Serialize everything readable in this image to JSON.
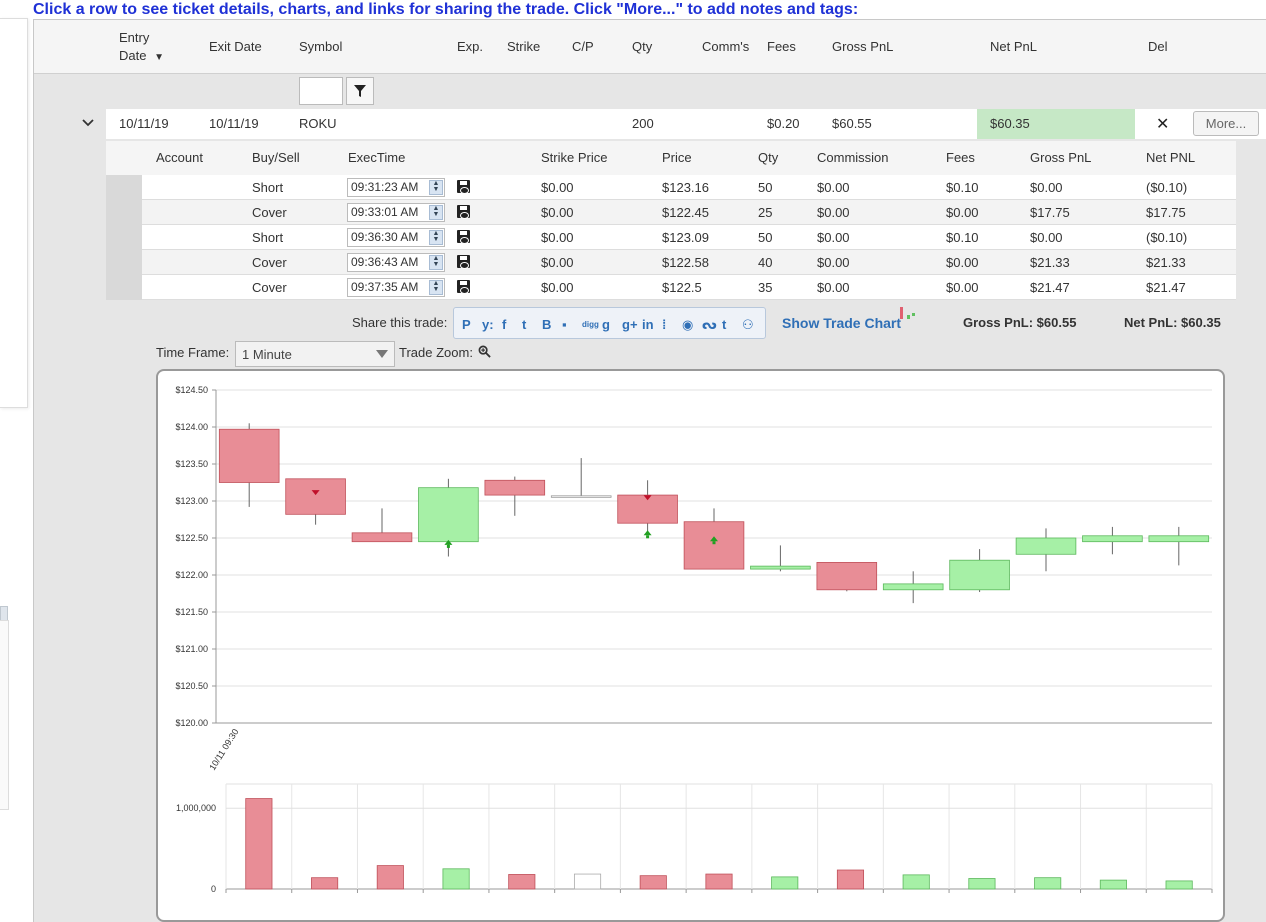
{
  "instructions": "Click a row to see ticket details, charts, and links for sharing the trade. Click \"More...\" to add notes and tags:",
  "grid": {
    "columns": {
      "entry_date_line1": "Entry",
      "entry_date_line2": "Date",
      "exit_date": "Exit Date",
      "symbol": "Symbol",
      "exp": "Exp.",
      "strike": "Strike",
      "cp": "C/P",
      "qty": "Qty",
      "comms": "Comm's",
      "fees": "Fees",
      "gross_pnl": "Gross PnL",
      "net_pnl": "Net PnL",
      "del": "Del"
    },
    "sort_indicator": "▼",
    "filter_value": ""
  },
  "trade": {
    "entry_date": "10/11/19",
    "exit_date": "10/11/19",
    "symbol": "ROKU",
    "qty": "200",
    "fees": "$0.20",
    "gross_pnl": "$60.55",
    "net_pnl": "$60.35",
    "delete_symbol": "✕",
    "more_label": "More..."
  },
  "details": {
    "headers": {
      "account": "Account",
      "buy_sell": "Buy/Sell",
      "exec_time": "ExecTime",
      "strike_price": "Strike Price",
      "price": "Price",
      "qty": "Qty",
      "commission": "Commission",
      "fees": "Fees",
      "gross_pnl": "Gross PnL",
      "net_pnl": "Net PNL"
    },
    "rows": [
      {
        "account": "",
        "side": "Short",
        "time": "09:31:23 AM",
        "strike": "$0.00",
        "price": "$123.16",
        "qty": "50",
        "commission": "$0.00",
        "fees": "$0.10",
        "gross": "$0.00",
        "net": "($0.10)"
      },
      {
        "account": "",
        "side": "Cover",
        "time": "09:33:01 AM",
        "strike": "$0.00",
        "price": "$122.45",
        "qty": "25",
        "commission": "$0.00",
        "fees": "$0.00",
        "gross": "$17.75",
        "net": "$17.75"
      },
      {
        "account": "",
        "side": "Short",
        "time": "09:36:30 AM",
        "strike": "$0.00",
        "price": "$123.09",
        "qty": "50",
        "commission": "$0.00",
        "fees": "$0.10",
        "gross": "$0.00",
        "net": "($0.10)"
      },
      {
        "account": "",
        "side": "Cover",
        "time": "09:36:43 AM",
        "strike": "$0.00",
        "price": "$122.58",
        "qty": "40",
        "commission": "$0.00",
        "fees": "$0.00",
        "gross": "$21.33",
        "net": "$21.33"
      },
      {
        "account": "",
        "side": "Cover",
        "time": "09:37:35 AM",
        "strike": "$0.00",
        "price": "$122.5",
        "qty": "35",
        "commission": "$0.00",
        "fees": "$0.00",
        "gross": "$21.47",
        "net": "$21.47"
      }
    ]
  },
  "share": {
    "label": "Share this trade:",
    "icons": [
      "pinterest-icon",
      "yahoo-icon",
      "facebook-icon",
      "twitter-icon",
      "blogger-icon",
      "delicious-icon",
      "digg-icon",
      "google-icon",
      "google-plus-icon",
      "linkedin-icon",
      "myspace-icon",
      "reddit-icon",
      "stumbleupon-icon",
      "tumblr-icon",
      "friends-icon"
    ],
    "icon_glyphs": [
      "P",
      "y:",
      "f",
      "t",
      "B",
      "▪",
      "digg",
      "g",
      "g+",
      "in",
      "⁞",
      "◉",
      "ᔓ",
      "t",
      "⚇"
    ],
    "show_chart_label": "Show Trade Chart",
    "gross_summary": "Gross PnL: $60.55",
    "net_summary": "Net PnL: $60.35"
  },
  "chart_controls": {
    "timeframe_label": "Time Frame:",
    "timeframe_value": "1 Minute",
    "zoom_label": "Trade Zoom:"
  },
  "colors": {
    "accent": "#1f31d6",
    "link": "#2f6fb6",
    "bear": "#e88d96",
    "bull": "#a6f0a6",
    "net_pnl_bg": "#c6e8c6"
  },
  "chart_data": {
    "type": "candlestick",
    "x_tick_labels": [
      "10/11 09:30"
    ],
    "ylim": [
      120.0,
      124.5
    ],
    "y_tick_labels": [
      "$124.50",
      "$124.00",
      "$123.50",
      "$123.00",
      "$122.50",
      "$122.00",
      "$121.50",
      "$121.00",
      "$120.50",
      "$120.00"
    ],
    "candles": [
      {
        "open": 123.97,
        "high": 124.05,
        "low": 122.92,
        "close": 123.25
      },
      {
        "open": 123.3,
        "high": 123.3,
        "low": 122.68,
        "close": 122.82
      },
      {
        "open": 122.57,
        "high": 122.9,
        "low": 122.45,
        "close": 122.45
      },
      {
        "open": 122.45,
        "high": 123.3,
        "low": 122.25,
        "close": 123.18
      },
      {
        "open": 123.28,
        "high": 123.33,
        "low": 122.8,
        "close": 123.08
      },
      {
        "open": 123.07,
        "high": 123.58,
        "low": 123.07,
        "close": 123.07
      },
      {
        "open": 123.08,
        "high": 123.28,
        "low": 122.58,
        "close": 122.7
      },
      {
        "open": 122.72,
        "high": 122.9,
        "low": 122.08,
        "close": 122.08
      },
      {
        "open": 122.08,
        "high": 122.4,
        "low": 122.05,
        "close": 122.12
      },
      {
        "open": 122.17,
        "high": 122.17,
        "low": 121.78,
        "close": 121.8
      },
      {
        "open": 121.8,
        "high": 122.05,
        "low": 121.62,
        "close": 121.88
      },
      {
        "open": 121.8,
        "high": 122.35,
        "low": 121.77,
        "close": 122.2
      },
      {
        "open": 122.28,
        "high": 122.63,
        "low": 122.05,
        "close": 122.5
      },
      {
        "open": 122.45,
        "high": 122.65,
        "low": 122.28,
        "close": 122.53
      },
      {
        "open": 122.45,
        "high": 122.65,
        "low": 122.13,
        "close": 122.53
      }
    ],
    "markers": [
      {
        "candle": 1,
        "price": 123.12,
        "side": "short"
      },
      {
        "candle": 3,
        "price": 122.42,
        "side": "cover"
      },
      {
        "candle": 6,
        "price": 123.05,
        "side": "short"
      },
      {
        "candle": 6,
        "price": 122.55,
        "side": "cover"
      },
      {
        "candle": 7,
        "price": 122.47,
        "side": "cover"
      }
    ],
    "volume": {
      "y_tick_labels": [
        "1,000,000",
        "0"
      ],
      "ylim": [
        0,
        1300000
      ],
      "values": [
        1120000,
        140000,
        290000,
        250000,
        180000,
        185000,
        165000,
        185000,
        150000,
        235000,
        175000,
        130000,
        140000,
        110000,
        100000
      ],
      "colors": [
        "bear",
        "bear",
        "bear",
        "bull",
        "bear",
        "neutral",
        "bear",
        "bear",
        "bull",
        "bear",
        "bull",
        "bull",
        "bull",
        "bull",
        "bull"
      ]
    }
  }
}
